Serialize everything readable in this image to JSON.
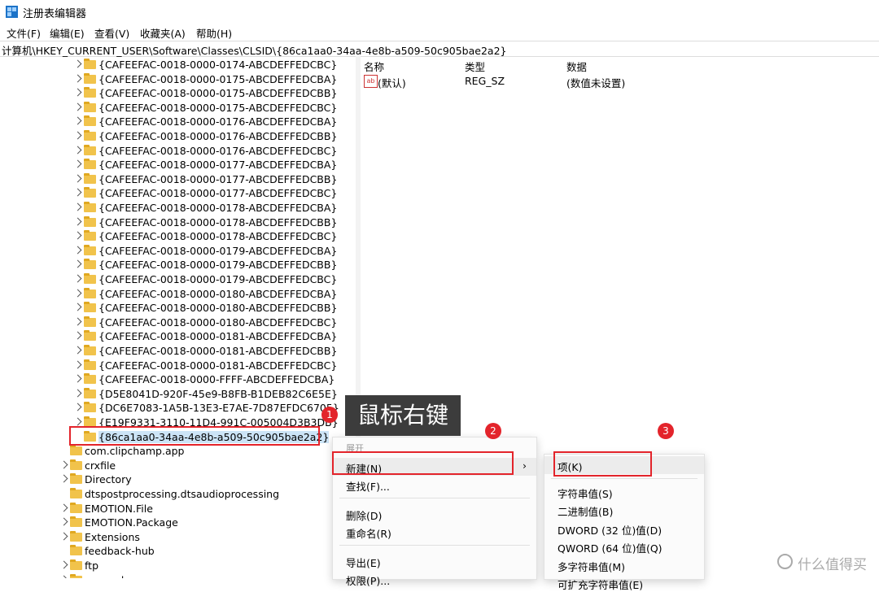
{
  "window": {
    "title": "注册表编辑器"
  },
  "menu": [
    "文件(F)",
    "编辑(E)",
    "查看(V)",
    "收藏夹(A)",
    "帮助(H)"
  ],
  "address": "计算机\\HKEY_CURRENT_USER\\Software\\Classes\\CLSID\\{86ca1aa0-34aa-4e8b-a509-50c905bae2a2}",
  "tree": [
    {
      "label": "{CAFEEFAC-0018-0000-0174-ABCDEFFEDCBC}",
      "level": 2,
      "chevron": true
    },
    {
      "label": "{CAFEEFAC-0018-0000-0175-ABCDEFFEDCBA}",
      "level": 2,
      "chevron": true
    },
    {
      "label": "{CAFEEFAC-0018-0000-0175-ABCDEFFEDCBB}",
      "level": 2,
      "chevron": true
    },
    {
      "label": "{CAFEEFAC-0018-0000-0175-ABCDEFFEDCBC}",
      "level": 2,
      "chevron": true
    },
    {
      "label": "{CAFEEFAC-0018-0000-0176-ABCDEFFEDCBA}",
      "level": 2,
      "chevron": true
    },
    {
      "label": "{CAFEEFAC-0018-0000-0176-ABCDEFFEDCBB}",
      "level": 2,
      "chevron": true
    },
    {
      "label": "{CAFEEFAC-0018-0000-0176-ABCDEFFEDCBC}",
      "level": 2,
      "chevron": true
    },
    {
      "label": "{CAFEEFAC-0018-0000-0177-ABCDEFFEDCBA}",
      "level": 2,
      "chevron": true
    },
    {
      "label": "{CAFEEFAC-0018-0000-0177-ABCDEFFEDCBB}",
      "level": 2,
      "chevron": true
    },
    {
      "label": "{CAFEEFAC-0018-0000-0177-ABCDEFFEDCBC}",
      "level": 2,
      "chevron": true
    },
    {
      "label": "{CAFEEFAC-0018-0000-0178-ABCDEFFEDCBA}",
      "level": 2,
      "chevron": true
    },
    {
      "label": "{CAFEEFAC-0018-0000-0178-ABCDEFFEDCBB}",
      "level": 2,
      "chevron": true
    },
    {
      "label": "{CAFEEFAC-0018-0000-0178-ABCDEFFEDCBC}",
      "level": 2,
      "chevron": true
    },
    {
      "label": "{CAFEEFAC-0018-0000-0179-ABCDEFFEDCBA}",
      "level": 2,
      "chevron": true
    },
    {
      "label": "{CAFEEFAC-0018-0000-0179-ABCDEFFEDCBB}",
      "level": 2,
      "chevron": true
    },
    {
      "label": "{CAFEEFAC-0018-0000-0179-ABCDEFFEDCBC}",
      "level": 2,
      "chevron": true
    },
    {
      "label": "{CAFEEFAC-0018-0000-0180-ABCDEFFEDCBA}",
      "level": 2,
      "chevron": true
    },
    {
      "label": "{CAFEEFAC-0018-0000-0180-ABCDEFFEDCBB}",
      "level": 2,
      "chevron": true
    },
    {
      "label": "{CAFEEFAC-0018-0000-0180-ABCDEFFEDCBC}",
      "level": 2,
      "chevron": true
    },
    {
      "label": "{CAFEEFAC-0018-0000-0181-ABCDEFFEDCBA}",
      "level": 2,
      "chevron": true
    },
    {
      "label": "{CAFEEFAC-0018-0000-0181-ABCDEFFEDCBB}",
      "level": 2,
      "chevron": true
    },
    {
      "label": "{CAFEEFAC-0018-0000-0181-ABCDEFFEDCBC}",
      "level": 2,
      "chevron": true
    },
    {
      "label": "{CAFEEFAC-0018-0000-FFFF-ABCDEFFEDCBA}",
      "level": 2,
      "chevron": true
    },
    {
      "label": "{D5E8041D-920F-45e9-B8FB-B1DEB82C6E5E}",
      "level": 2,
      "chevron": true
    },
    {
      "label": "{DC6E7083-1A5B-13E3-E7AE-7D87EFDC6705}",
      "level": 2,
      "chevron": true
    },
    {
      "label": "{E19F9331-3110-11D4-991C-005004D3B3DB}",
      "level": 2,
      "chevron": true
    },
    {
      "label": "{86ca1aa0-34aa-4e8b-a509-50c905bae2a2}",
      "level": 2,
      "chevron": false,
      "selected": true
    },
    {
      "label": "com.clipchamp.app",
      "level": 1,
      "chevron": false
    },
    {
      "label": "crxfile",
      "level": 1,
      "chevron": true
    },
    {
      "label": "Directory",
      "level": 1,
      "chevron": true
    },
    {
      "label": "dtspostprocessing.dtsaudioprocessing",
      "level": 1,
      "chevron": false
    },
    {
      "label": "EMOTION.File",
      "level": 1,
      "chevron": true
    },
    {
      "label": "EMOTION.Package",
      "level": 1,
      "chevron": true
    },
    {
      "label": "Extensions",
      "level": 1,
      "chevron": true
    },
    {
      "label": "feedback-hub",
      "level": 1,
      "chevron": false
    },
    {
      "label": "ftp",
      "level": 1,
      "chevron": true
    },
    {
      "label": "gnucash",
      "level": 1,
      "chevron": true
    }
  ],
  "values_pane": {
    "columns": [
      "名称",
      "类型",
      "数据"
    ],
    "rows": [
      {
        "icon": "ab",
        "name": "(默认)",
        "type": "REG_SZ",
        "data": "(数值未设置)"
      }
    ]
  },
  "context_menu": {
    "items": [
      {
        "label": "展开",
        "disabled": true
      },
      {
        "label": "新建(N)",
        "submenu": true,
        "hover": true
      },
      {
        "label": "查找(F)..."
      },
      {
        "sep": true
      },
      {
        "label": "删除(D)"
      },
      {
        "label": "重命名(R)"
      },
      {
        "sep": true
      },
      {
        "label": "导出(E)"
      },
      {
        "label": "权限(P)..."
      }
    ]
  },
  "submenu": {
    "items": [
      {
        "label": "项(K)",
        "hover": true
      },
      {
        "sep": true
      },
      {
        "label": "字符串值(S)"
      },
      {
        "label": "二进制值(B)"
      },
      {
        "label": "DWORD (32 位)值(D)"
      },
      {
        "label": "QWORD (64 位)值(Q)"
      },
      {
        "label": "多字符串值(M)"
      },
      {
        "label": "可扩充字符串值(E)"
      }
    ]
  },
  "annotations": {
    "badges": [
      "1",
      "2",
      "3"
    ],
    "callout": "鼠标右键",
    "watermark": "什么值得买"
  },
  "colors": {
    "annotation_red": "#e3242b",
    "selection_blue": "#cce4f7",
    "folder_yellow": "#f1c34b"
  }
}
